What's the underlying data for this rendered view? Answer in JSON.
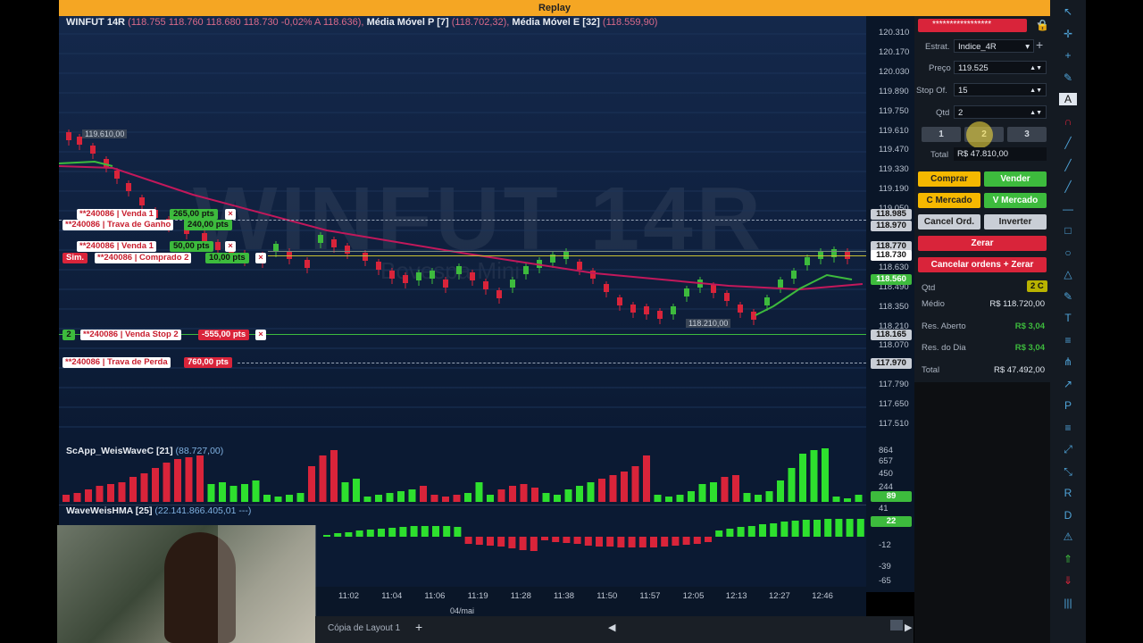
{
  "window": {
    "title": "Replay"
  },
  "chart": {
    "title": "WINFUT 14R",
    "ohlc": "(118.755  118.760  118.680  118.730  -0,02%  A 118.636),",
    "ma_p_label": "Média Móvel P [7]",
    "ma_p_value": "(118.702,32),",
    "ma_e_label": "Média Móvel E [32]",
    "ma_e_value": "(118.559,90)",
    "watermark": "WINFUT 14R",
    "watermark2": "Bovespa Mini",
    "price_ticks": [
      "120.310",
      "120.170",
      "120.030",
      "119.890",
      "119.750",
      "119.610",
      "119.470",
      "119.330",
      "119.190",
      "119.050",
      "118.910",
      "118.770",
      "118.630",
      "118.490",
      "118.350",
      "118.210",
      "118.070",
      "117.930",
      "117.790",
      "117.650",
      "117.510"
    ],
    "high_label": "119.610,00",
    "low_label": "118.210,00",
    "price_tags": {
      "t1": "118.985",
      "t2": "118.970",
      "t3": "118.770",
      "t4": "118.730",
      "t5": "118.560",
      "t6": "118.165",
      "t7": "117.970"
    },
    "orders": {
      "o1_name": "**240086 | Venda 1",
      "o1_pts": "265,00 pts",
      "o2_name": "**240086 | Trava de Ganho",
      "o2_pts": "240,00 pts",
      "o3_name": "**240086 | Venda 1",
      "o3_pts": "50,00 pts",
      "sim": "Sim.",
      "o4_name": "**240086 | Comprado 2",
      "o4_pts": "10,00 pts",
      "o5_qty": "2",
      "o5_name": "**240086 | Venda Stop 2",
      "o5_pts": "-555,00 pts",
      "o6_name": "**240086 | Trava de Perda",
      "o6_pts": "760,00 pts",
      "close": "×"
    }
  },
  "indicator1": {
    "title": "ScApp_WeisWaveC [21]",
    "value": "(88.727,00)",
    "ticks": [
      "864",
      "657",
      "450",
      "244",
      "89",
      "41"
    ]
  },
  "indicator2": {
    "title": "WaveWeisHMA [25]",
    "value": "(22.141.866.405,01 ---)",
    "ticks": [
      "22",
      "-12",
      "-39",
      "-65"
    ]
  },
  "time_axis": {
    "ticks": [
      "11:02",
      "11:04",
      "11:06",
      "11:19",
      "11:28",
      "11:38",
      "11:50",
      "11:57",
      "12:05",
      "12:13",
      "12:27",
      "12:46"
    ],
    "date": "04/mai"
  },
  "bottom": {
    "tab": "Cópia de Layout 1",
    "add": "+"
  },
  "panel": {
    "account": "*****************",
    "estrat_label": "Estrat.",
    "estrat_value": "Indice_4R",
    "preco_label": "Preço",
    "preco_value": "119.525",
    "stop_label": "Stop Of.",
    "stop_value": "15",
    "qtd_label": "Qtd",
    "qtd_value": "2",
    "qty_buttons": [
      "1",
      "2",
      "3"
    ],
    "total_label": "Total",
    "total_value": "R$ 47.810,00",
    "comprar": "Comprar",
    "vender": "Vender",
    "c_mercado": "C Mercado",
    "v_mercado": "V Mercado",
    "cancel_ord": "Cancel Ord.",
    "inverter": "Inverter",
    "zerar": "Zerar",
    "cancelar_zerar": "Cancelar ordens + Zerar",
    "pos_qtd_label": "Qtd",
    "pos_qtd_value": "2 C",
    "medio_label": "Médio",
    "medio_value": "R$ 118.720,00",
    "res_aberto_label": "Res. Aberto",
    "res_aberto_value": "R$ 3,04",
    "res_dia_label": "Res. do Dia",
    "res_dia_value": "R$ 3,04",
    "total2_label": "Total",
    "total2_value": "R$ 47.492,00"
  },
  "toolbar": {
    "icons": [
      "cursor-icon",
      "crosshair-icon",
      "cross-icon",
      "pencil-icon",
      "text-a-icon",
      "magnet-icon",
      "line-icon",
      "ray-icon",
      "channel-icon",
      "hline-icon",
      "rect-icon",
      "circle-icon",
      "triangle-icon",
      "brush-icon",
      "text-icon",
      "fib-icon",
      "pitchfork-icon",
      "arrow-icon",
      "note-icon",
      "gann-icon",
      "measure-icon",
      "zoom-icon",
      "r-icon",
      "d-icon",
      "alert-icon",
      "buy-arrow-icon",
      "sell-arrow-icon",
      "bars-icon"
    ]
  },
  "colors": {
    "accent": "#f5a623",
    "buy": "#3dbb3d",
    "sell": "#d9243a",
    "bg": "#0b1a33"
  }
}
